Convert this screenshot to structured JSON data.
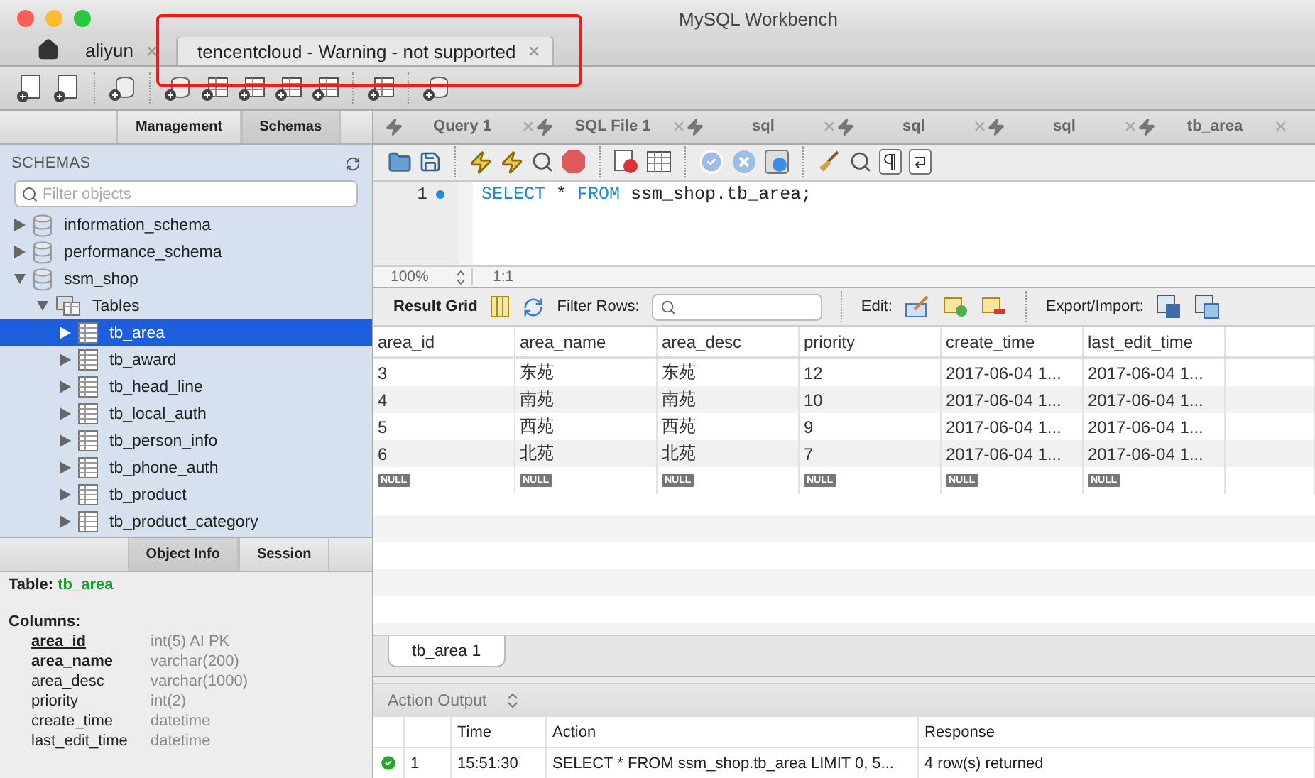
{
  "window": {
    "title": "MySQL Workbench"
  },
  "connection_tabs": [
    {
      "label": "aliyun",
      "selected": false
    },
    {
      "label": "tencentcloud - Warning - not supported",
      "selected": true
    }
  ],
  "sidebar": {
    "tabs": [
      {
        "label": "Management",
        "selected": false
      },
      {
        "label": "Schemas",
        "selected": true
      }
    ],
    "title": "SCHEMAS",
    "filter": {
      "placeholder": "Filter objects"
    },
    "tree": [
      {
        "label": "information_schema",
        "kind": "schema",
        "expanded": false,
        "selected": false
      },
      {
        "label": "performance_schema",
        "kind": "schema",
        "expanded": false,
        "selected": false
      },
      {
        "label": "ssm_shop",
        "kind": "schema",
        "expanded": true,
        "selected": false,
        "children": [
          {
            "label": "Tables",
            "kind": "folder",
            "expanded": true,
            "selected": false,
            "children": [
              {
                "label": "tb_area",
                "kind": "table",
                "expanded": false,
                "selected": true
              },
              {
                "label": "tb_award",
                "kind": "table",
                "expanded": false,
                "selected": false
              },
              {
                "label": "tb_head_line",
                "kind": "table",
                "expanded": false,
                "selected": false
              },
              {
                "label": "tb_local_auth",
                "kind": "table",
                "expanded": false,
                "selected": false
              },
              {
                "label": "tb_person_info",
                "kind": "table",
                "expanded": false,
                "selected": false
              },
              {
                "label": "tb_phone_auth",
                "kind": "table",
                "expanded": false,
                "selected": false
              },
              {
                "label": "tb_product",
                "kind": "table",
                "expanded": false,
                "selected": false
              },
              {
                "label": "tb_product_category",
                "kind": "table",
                "expanded": false,
                "selected": false
              }
            ]
          }
        ]
      }
    ]
  },
  "info_panel": {
    "tabs": [
      {
        "label": "Object Info",
        "selected": true
      },
      {
        "label": "Session",
        "selected": false
      }
    ],
    "table_label": "Table:",
    "table_name": "tb_area",
    "columns_label": "Columns:",
    "columns": [
      {
        "name": "area_id",
        "type": "int(5) AI PK",
        "kind": "primary"
      },
      {
        "name": "area_name",
        "type": "varchar(200)",
        "kind": "required"
      },
      {
        "name": "area_desc",
        "type": "varchar(1000)",
        "kind": "plain"
      },
      {
        "name": "priority",
        "type": "int(2)",
        "kind": "plain"
      },
      {
        "name": "create_time",
        "type": "datetime",
        "kind": "plain"
      },
      {
        "name": "last_edit_time",
        "type": "datetime",
        "kind": "plain"
      }
    ]
  },
  "query_tabs": [
    {
      "label": "Query 1"
    },
    {
      "label": "SQL File 1"
    },
    {
      "label": "sql"
    },
    {
      "label": "sql"
    },
    {
      "label": "sql"
    },
    {
      "label": "tb_area"
    }
  ],
  "editor": {
    "lines": [
      {
        "number": "1",
        "tokens": [
          {
            "text": "SELECT",
            "kind": "keyword"
          },
          {
            "text": " * ",
            "kind": "plain"
          },
          {
            "text": "FROM",
            "kind": "keyword"
          },
          {
            "text": " ssm_shop.tb_area;",
            "kind": "plain"
          }
        ]
      }
    ],
    "zoom": "100%",
    "position": "1:1"
  },
  "result": {
    "title": "Result Grid",
    "filter_label": "Filter Rows:",
    "edit_label": "Edit:",
    "export_label": "Export/Import:",
    "columns": [
      "area_id",
      "area_name",
      "area_desc",
      "priority",
      "create_time",
      "last_edit_time"
    ],
    "rows": [
      {
        "kind": "data",
        "cells": [
          "3",
          "东苑",
          "东苑",
          "12",
          "2017-06-04 1...",
          "2017-06-04 1..."
        ]
      },
      {
        "kind": "data",
        "cells": [
          "4",
          "南苑",
          "南苑",
          "10",
          "2017-06-04 1...",
          "2017-06-04 1..."
        ]
      },
      {
        "kind": "data",
        "cells": [
          "5",
          "西苑",
          "西苑",
          "9",
          "2017-06-04 1...",
          "2017-06-04 1..."
        ]
      },
      {
        "kind": "data",
        "cells": [
          "6",
          "北苑",
          "北苑",
          "7",
          "2017-06-04 1...",
          "2017-06-04 1..."
        ]
      },
      {
        "kind": "null",
        "cells": [
          "NULL",
          "NULL",
          "NULL",
          "NULL",
          "NULL",
          "NULL"
        ]
      }
    ]
  },
  "result_tabs": [
    {
      "label": "tb_area 1",
      "selected": true
    }
  ],
  "action_output": {
    "title": "Action Output",
    "columns": [
      "Time",
      "Action",
      "Response"
    ],
    "rows": [
      {
        "kind": "success",
        "number": "1",
        "time": "15:51:30",
        "action": "SELECT * FROM ssm_shop.tb_area LIMIT 0, 5...",
        "response": "4 row(s) returned"
      }
    ]
  }
}
